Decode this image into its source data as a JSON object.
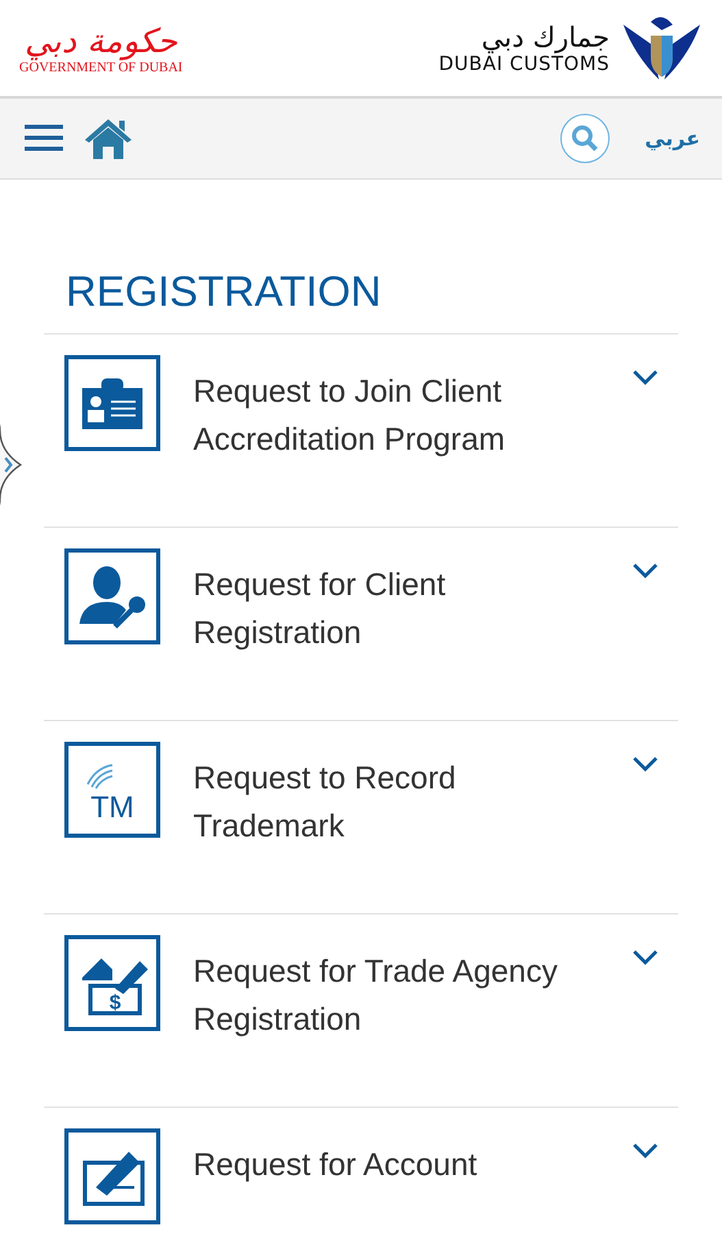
{
  "header": {
    "government_logo": {
      "arabic": "حكومة دبي",
      "english": "GOVERNMENT OF DUBAI"
    },
    "customs_logo": {
      "arabic": "جمارك دبي",
      "english": "DUBAI CUSTOMS"
    }
  },
  "toolbar": {
    "language": "عربي"
  },
  "section": {
    "title": "REGISTRATION"
  },
  "items": [
    {
      "kind": "badge",
      "title": "Request to Join Client Accreditation Program",
      "expanded": false
    },
    {
      "kind": "user-key",
      "title": "Request for Client Registration",
      "expanded": false
    },
    {
      "kind": "trademark",
      "icon_text": "TM",
      "title": "Request to Record Trademark",
      "expanded": false
    },
    {
      "kind": "agency",
      "icon_text": "$",
      "title": "Request for Trade Agency Registration",
      "expanded": false
    },
    {
      "kind": "account",
      "title": "Request for Account",
      "expanded": false
    }
  ]
}
